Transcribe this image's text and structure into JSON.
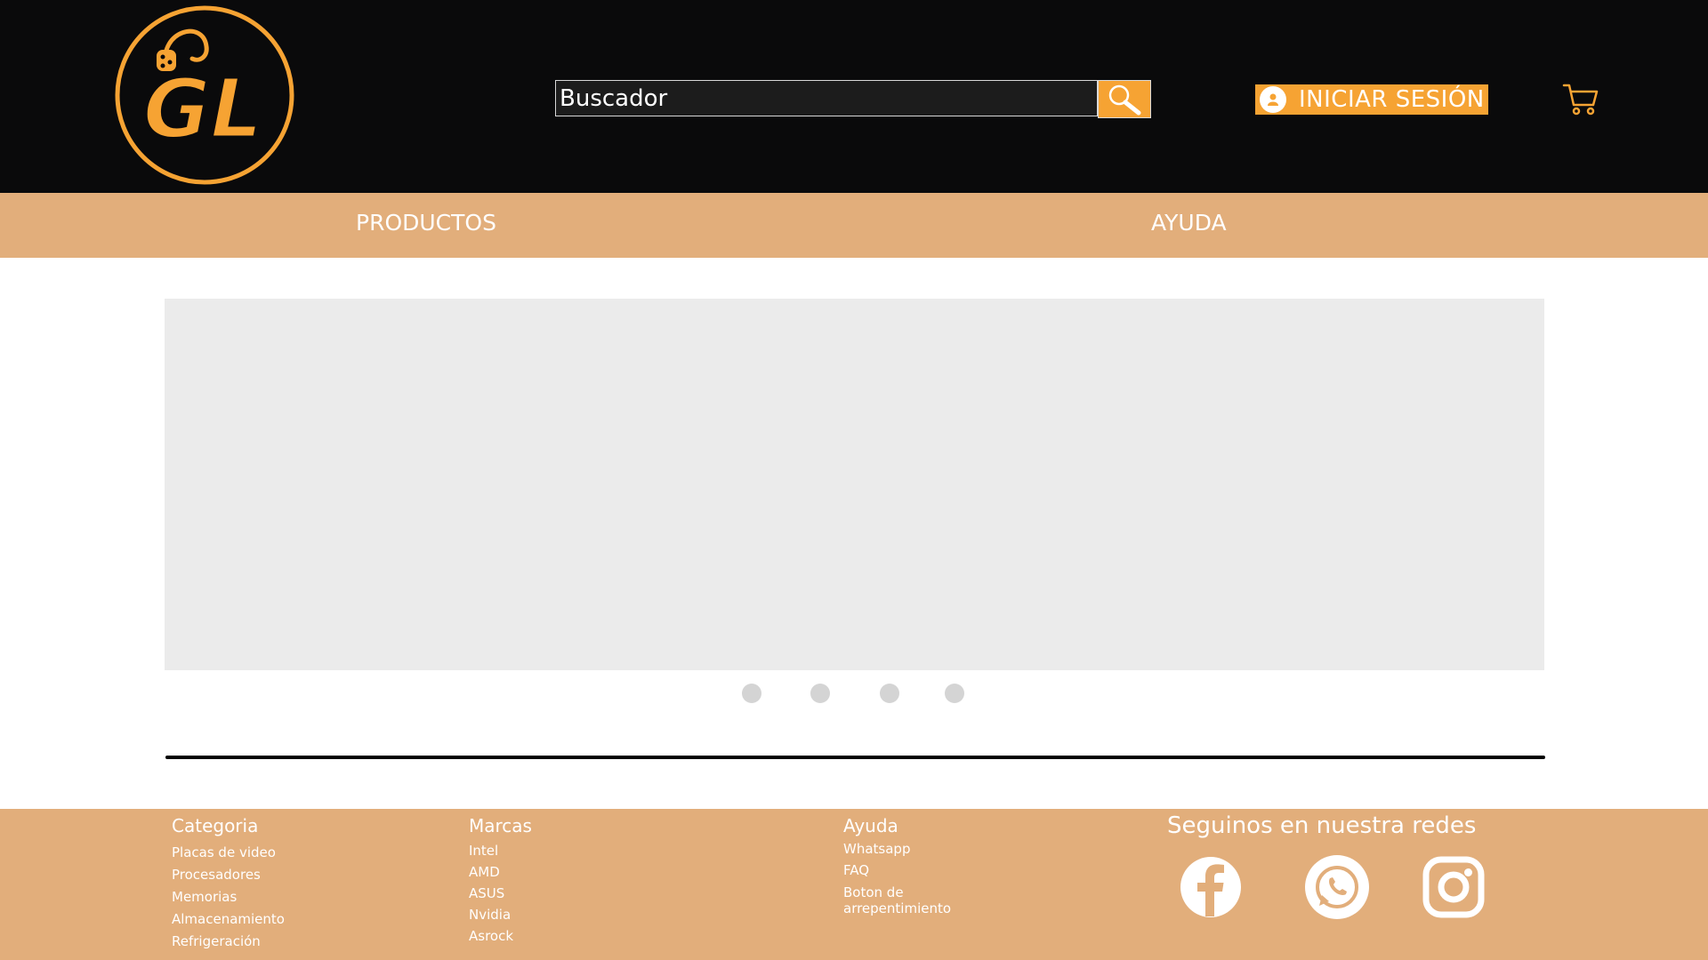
{
  "header": {
    "logo_text": "GL",
    "search": {
      "placeholder": "Buscador"
    },
    "login_label": "INICIAR SESIÓN"
  },
  "nav": {
    "items": [
      {
        "label": "PRODUCTOS"
      },
      {
        "label": "AYUDA"
      }
    ]
  },
  "carousel": {
    "dot_count": 4
  },
  "footer": {
    "columns": [
      {
        "title": "Categoria",
        "links": [
          "Placas de video",
          "Procesadores",
          "Memorias",
          "Almacenamiento",
          "Refrigeración"
        ]
      },
      {
        "title": "Marcas",
        "links": [
          "Intel",
          "AMD",
          "ASUS",
          "Nvidia",
          "Asrock"
        ]
      },
      {
        "title": "Ayuda",
        "links": [
          "Whatsapp",
          "FAQ",
          "Boton  de arrepentimiento"
        ]
      }
    ],
    "social_title": "Seguinos en nuestra redes",
    "social": [
      "facebook-icon",
      "whatsapp-icon",
      "instagram-icon"
    ]
  },
  "colors": {
    "header_bg": "#0a0a0b",
    "accent_orange": "#f6a333",
    "nav_footer_bg": "#e2ae7b",
    "carousel_bg": "#ebebeb"
  }
}
